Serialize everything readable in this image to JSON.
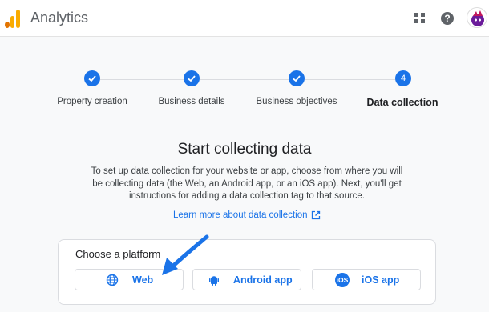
{
  "header": {
    "app_title": "Analytics"
  },
  "stepper": {
    "steps": [
      {
        "label": "Property creation",
        "status": "done"
      },
      {
        "label": "Business details",
        "status": "done"
      },
      {
        "label": "Business objectives",
        "status": "done"
      },
      {
        "label": "Data collection",
        "status": "active",
        "number": "4"
      }
    ]
  },
  "main": {
    "heading": "Start collecting data",
    "description": "To set up data collection for your website or app, choose from where you will be collecting data (the Web, an Android app, or an iOS app). Next, you'll get instructions for adding a data collection tag to that source.",
    "learn_more": "Learn more about data collection"
  },
  "platform_card": {
    "title": "Choose a platform",
    "options": [
      {
        "label": "Web",
        "icon": "globe-icon"
      },
      {
        "label": "Android app",
        "icon": "android-icon"
      },
      {
        "label": "iOS app",
        "icon": "ios-icon",
        "icon_text": "iOS"
      }
    ]
  },
  "colors": {
    "accent": "#1a73e8",
    "logo_orange": "#e37400",
    "logo_yellow": "#f9ab00",
    "annotation_arrow": "#1a73e8"
  }
}
